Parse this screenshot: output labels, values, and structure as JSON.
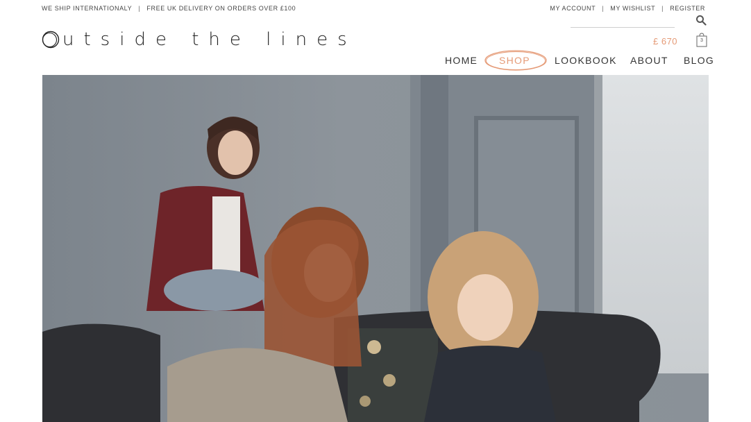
{
  "topbar": {
    "ship_text": "WE SHIP INTERNATIONALY",
    "delivery_text": "FREE UK DELIVERY ON ORDERS OVER £100",
    "separator": "|",
    "account_label": "MY ACCOUNT",
    "wishlist_label": "MY WISHLIST",
    "register_label": "REGISTER"
  },
  "search": {
    "icon": "search-icon"
  },
  "logo": {
    "text": "utside the lines",
    "lettering": "Outside the lines"
  },
  "cart": {
    "total": "£ 670",
    "count": "3",
    "icon": "shopping-bag-icon"
  },
  "nav": {
    "home": "HOME",
    "shop": "SHOP",
    "lookbook": "LOOKBOOK",
    "about": "ABOUT",
    "blog": "BLOG"
  },
  "colors": {
    "accent": "#e59a76",
    "text": "#333333"
  }
}
